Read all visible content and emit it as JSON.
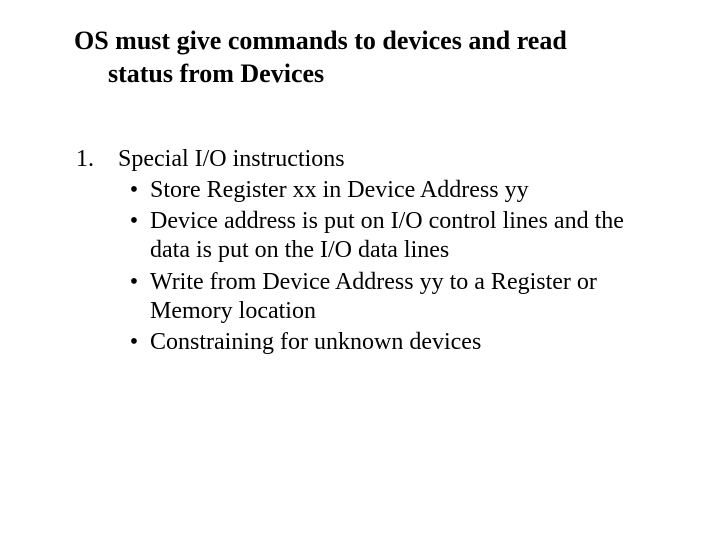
{
  "title": {
    "line1": "OS must give commands to devices and read",
    "line2": "status from Devices"
  },
  "list": {
    "marker": "1.",
    "heading": "Special I/O instructions",
    "bullets": [
      "Store Register xx in Device Address yy",
      "Device address is put on I/O control lines and the data is put on the I/O data lines",
      "Write from Device Address yy to a Register or Memory location",
      "Constraining for unknown devices"
    ]
  },
  "bullet_char": "•"
}
